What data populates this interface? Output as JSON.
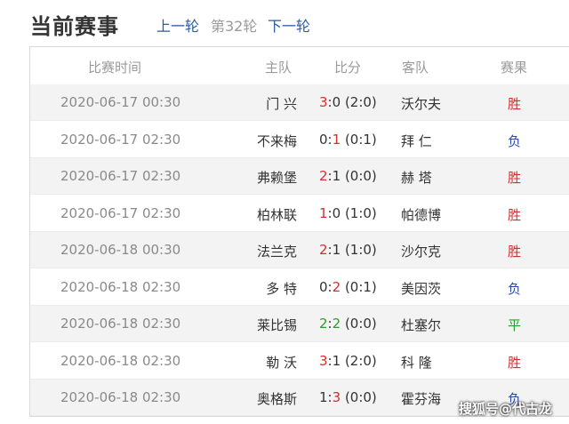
{
  "header": {
    "title": "当前赛事",
    "prev_round": "上一轮",
    "current_round": "第32轮",
    "next_round": "下一轮"
  },
  "table": {
    "columns": [
      "比赛时间",
      "主队",
      "比分",
      "客队",
      "赛果"
    ],
    "rows": [
      {
        "time": "2020-06-17 00:30",
        "home": "门 兴",
        "home_goals": "3",
        "away_goals": "0",
        "half": "(2:0)",
        "away": "沃尔夫",
        "result": "胜",
        "result_type": "win",
        "highlight": "home"
      },
      {
        "time": "2020-06-17 02:30",
        "home": "不来梅",
        "home_goals": "0",
        "away_goals": "1",
        "half": "(0:1)",
        "away": "拜 仁",
        "result": "负",
        "result_type": "lose",
        "highlight": "away"
      },
      {
        "time": "2020-06-17 02:30",
        "home": "弗赖堡",
        "home_goals": "2",
        "away_goals": "1",
        "half": "(0:0)",
        "away": "赫 塔",
        "result": "胜",
        "result_type": "win",
        "highlight": "home"
      },
      {
        "time": "2020-06-17 02:30",
        "home": "柏林联",
        "home_goals": "1",
        "away_goals": "0",
        "half": "(1:0)",
        "away": "帕德博",
        "result": "胜",
        "result_type": "win",
        "highlight": "home"
      },
      {
        "time": "2020-06-18 00:30",
        "home": "法兰克",
        "home_goals": "2",
        "away_goals": "1",
        "half": "(1:0)",
        "away": "沙尔克",
        "result": "胜",
        "result_type": "win",
        "highlight": "home"
      },
      {
        "time": "2020-06-18 02:30",
        "home": "多 特",
        "home_goals": "0",
        "away_goals": "2",
        "half": "(0:1)",
        "away": "美因茨",
        "result": "负",
        "result_type": "lose",
        "highlight": "away"
      },
      {
        "time": "2020-06-18 02:30",
        "home": "莱比锡",
        "home_goals": "2",
        "away_goals": "2",
        "half": "(0:0)",
        "away": "杜塞尔",
        "result": "平",
        "result_type": "draw",
        "highlight": "both"
      },
      {
        "time": "2020-06-18 02:30",
        "home": "勒 沃",
        "home_goals": "3",
        "away_goals": "1",
        "half": "(2:0)",
        "away": "科 隆",
        "result": "胜",
        "result_type": "win",
        "highlight": "home"
      },
      {
        "time": "2020-06-18 02:30",
        "home": "奥格斯",
        "home_goals": "1",
        "away_goals": "3",
        "half": "(0:0)",
        "away": "霍芬海",
        "result": "负",
        "result_type": "lose",
        "highlight": "away"
      }
    ]
  },
  "watermark": "搜狐号@代古龙",
  "colors": {
    "win": "#d42e2e",
    "lose": "#2a4aa8",
    "draw": "#2f9a2f",
    "link": "#2a5aa0"
  }
}
